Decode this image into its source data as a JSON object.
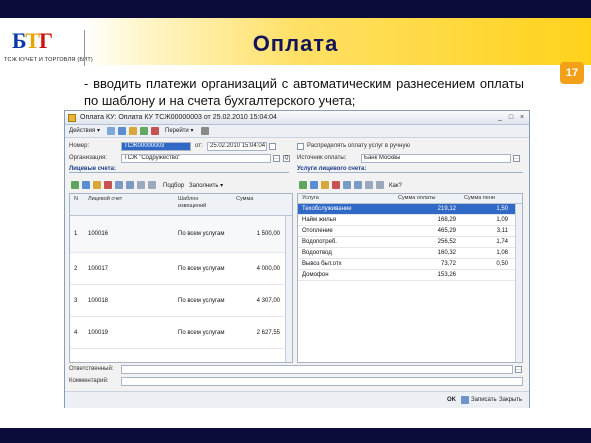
{
  "slide": {
    "logo_abbrev_1": "Б",
    "logo_abbrev_2": "Т",
    "logo_abbrev_3": "Г",
    "logo_caption": "ТСЖ КУЧЕТ И ТОРГОВЛЯ (БИТ)",
    "title": "Оплата",
    "page_number": "17",
    "text": "- вводить платежи организаций с автоматическим разнесением оплаты по шаблону и на счета бухгалтерского учета;",
    "colors": {
      "title": "#13135a",
      "badge": "#f3a019",
      "band": "#ffd21a",
      "dark_bar": "#0c0c3c"
    }
  },
  "window": {
    "title": "Оплата КУ: Оплата КУ ТСЖ00000003 от 25.02.2010 15:04:04",
    "toolbar": {
      "actions": "Действия ▾",
      "go": "Перейти ▾"
    },
    "form": {
      "number_label": "Номер:",
      "number_value": "ТСЖ00000003",
      "date_label": "от:",
      "date_value": "25.02.2010 15:04:04",
      "org_label": "Организация:",
      "org_value": "ТСЖ \"Содружество\"",
      "distribute_label": "Распределять оплату услуг в ручную",
      "source_label": "Источник оплаты:",
      "source_value": "Банк Москвы"
    },
    "left_panel": {
      "section_title": "Лицевые счета:",
      "toolbar": {
        "pick": "Подбор",
        "fill": "Заполнить ▾"
      },
      "columns": [
        "N",
        "Лицевой счет",
        "Шаблон извещений",
        "Сумма"
      ],
      "rows": [
        {
          "n": "1",
          "account": "100016",
          "template": "По всем услугам",
          "sum": "1 500,00"
        },
        {
          "n": "2",
          "account": "100017",
          "template": "По всем услугам",
          "sum": "4 000,00"
        },
        {
          "n": "3",
          "account": "100018",
          "template": "По всем услугам",
          "sum": "4 307,00"
        },
        {
          "n": "4",
          "account": "100019",
          "template": "По всем услугам",
          "sum": "2 627,55"
        }
      ]
    },
    "right_panel": {
      "section_title": "Услуги лицевого счета:",
      "toolbar": {
        "how": "Как?"
      },
      "columns": [
        "Услуга",
        "Сумма оплаты",
        "Сумма пени"
      ],
      "rows": [
        {
          "service": "Техобслуживание",
          "payment": "219,12",
          "penalty": "1,50"
        },
        {
          "service": "Найм жилья",
          "payment": "168,29",
          "penalty": "1,09"
        },
        {
          "service": "Отопление",
          "payment": "465,29",
          "penalty": "3,11"
        },
        {
          "service": "Водопотреб.",
          "payment": "256,52",
          "penalty": "1,74"
        },
        {
          "service": "Водоотвод",
          "payment": "160,32",
          "penalty": "1,08"
        },
        {
          "service": "Вывоз быт.отх",
          "payment": "73,72",
          "penalty": "0,50"
        },
        {
          "service": "Домофон",
          "payment": "153,26",
          "penalty": ""
        }
      ]
    },
    "footer": {
      "responsible_label": "Ответственный:",
      "comment_label": "Комментарий:",
      "ok": "OK",
      "save": "Записать",
      "close": "Закрыть"
    }
  }
}
